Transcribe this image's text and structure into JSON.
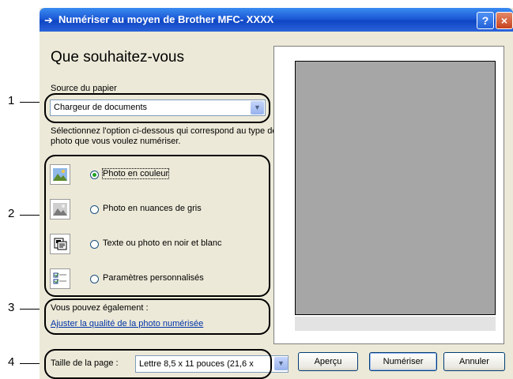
{
  "window": {
    "title": "Numériser au moyen de Brother MFC- XXXX",
    "help_button": "?",
    "close_button": "×"
  },
  "callouts": [
    "1",
    "2",
    "3",
    "4"
  ],
  "heading": "Que souhaitez-vous",
  "paper_source": {
    "label": "Source du papier",
    "selected": "Chargeur de documents"
  },
  "instructions": "Sélectionnez l'option ci-dessous qui correspond au type de photo que vous voulez numériser.",
  "scan_types": [
    {
      "label": "Photo en couleur",
      "selected": true,
      "icon": "color-photo-icon"
    },
    {
      "label": "Photo en nuances de gris",
      "selected": false,
      "icon": "grayscale-photo-icon"
    },
    {
      "label": "Texte ou photo en noir et blanc",
      "selected": false,
      "icon": "black-white-text-icon"
    },
    {
      "label": "Paramètres personnalisés",
      "selected": false,
      "icon": "custom-settings-icon"
    }
  ],
  "also": {
    "label": "Vous pouvez également :",
    "link": "Ajuster la qualité de la photo numérisée"
  },
  "page_size": {
    "label": "Taille de la page :",
    "selected": "Lettre 8,5 x 11 pouces (21,6 x"
  },
  "buttons": {
    "preview": "Aperçu",
    "scan": "Numériser",
    "cancel": "Annuler"
  },
  "colors": {
    "titlebar": "#0f46c4",
    "dialog_bg": "#ece9d8",
    "preview_page": "#a6a6a6",
    "link": "#0033a6"
  }
}
